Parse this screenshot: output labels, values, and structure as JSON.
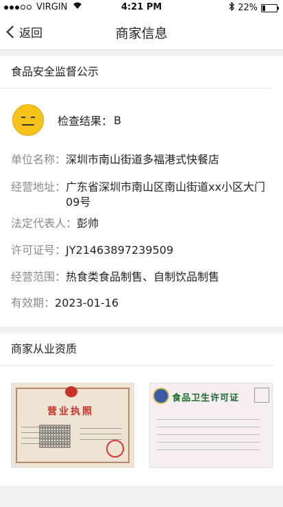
{
  "status_bar": {
    "carrier": "VIRGIN",
    "time": "4:21 PM",
    "battery": "22%",
    "battery_level": 0.22
  },
  "nav": {
    "back_label": "返回",
    "title": "商家信息"
  },
  "food_safety": {
    "section_title": "食品安全监督公示",
    "result_label": "检查结果：",
    "result_value": "B",
    "fields": [
      {
        "key": "单位名称：",
        "value": "深圳市南山街道多福港式快餐店"
      },
      {
        "key": "经营地址：",
        "value": "广东省深圳市南山区南山街道xx小区大门09号"
      },
      {
        "key": "法定代表人：",
        "value": "彭帅"
      },
      {
        "key": "许可证号：",
        "value": "JY21463897239509"
      },
      {
        "key": "经营范围：",
        "value": "热食类食品制售、自制饮品制售"
      },
      {
        "key": "有效期：",
        "value": "2023-01-16"
      }
    ]
  },
  "qualifications": {
    "section_title": "商家从业资质",
    "license_title": "营业执照",
    "food_permit_title": "食品卫生许可证"
  }
}
